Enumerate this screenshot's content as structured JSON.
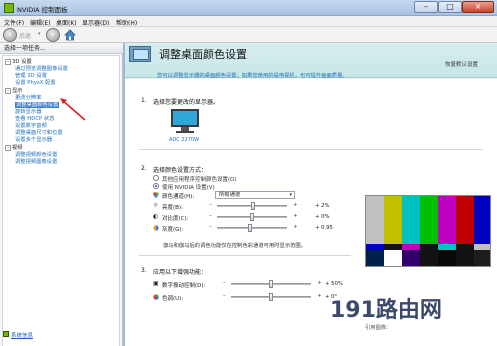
{
  "window": {
    "title": "NVIDIA 控制面板",
    "buttons": {
      "minimize": "–",
      "maximize": "□",
      "close": "×"
    }
  },
  "menu": [
    "文件(F)",
    "编辑(E)",
    "桌面(K)",
    "显示器(D)",
    "帮助(H)"
  ],
  "toolbar": {
    "back_label": "后退",
    "back_icon": "left-arrow-icon",
    "forward_icon": "right-arrow-icon",
    "home_icon": "home-icon"
  },
  "left": {
    "task_header": "选择一项任务...",
    "tree": [
      {
        "label": "3D 设置",
        "kind": "cat",
        "toggle": "–"
      },
      {
        "label": "通过预览调整图像设置",
        "kind": "leaf"
      },
      {
        "label": "管理 3D 设置",
        "kind": "leaf"
      },
      {
        "label": "设置 PhysX 配置",
        "kind": "leaf"
      },
      {
        "label": "显示",
        "kind": "cat",
        "toggle": "–"
      },
      {
        "label": "更改分辨率",
        "kind": "leaf"
      },
      {
        "label": "调整桌面颜色设置",
        "kind": "leaf",
        "selected": true
      },
      {
        "label": "旋转显示器",
        "kind": "leaf"
      },
      {
        "label": "查看 HDCP 状态",
        "kind": "leaf"
      },
      {
        "label": "设置数字音频",
        "kind": "leaf"
      },
      {
        "label": "调整桌面尺寸和位置",
        "kind": "leaf"
      },
      {
        "label": "设置多个显示器",
        "kind": "leaf"
      },
      {
        "label": "视频",
        "kind": "cat",
        "toggle": "–"
      },
      {
        "label": "调整视频颜色设置",
        "kind": "leaf"
      },
      {
        "label": "调整视频图像设置",
        "kind": "leaf"
      }
    ],
    "sysinfo": "系统信息"
  },
  "right": {
    "title": "调整桌面颜色设置",
    "restore": "恢复默认设置",
    "description": "您可以调整显示器的桌面颜色设置，如果您使用的是电视机，也可提升画面质量。",
    "section1": {
      "num": "1.",
      "title": "选择您要更改的显示器。",
      "monitor": "AOC 2270W"
    },
    "section2": {
      "num": "2.",
      "title": "选择颜色设置方式：",
      "option_other": "其他应用程序控制颜色设置(O)",
      "option_nvidia": "使用 NVIDIA 设置(V)",
      "channel_label": "颜色通道(H):",
      "channel_value": "所有通道",
      "brightness": {
        "label": "亮度(B):",
        "value": "+ 2%",
        "level": 0.52
      },
      "contrast": {
        "label": "对比度(C):",
        "value": "+ 0%",
        "level": 0.5
      },
      "gamma": {
        "label": "灰度(G):",
        "value": "+ 0.95",
        "level": 0.47
      },
      "note": "伽马和伽马后的调色功能仅在控制色彩通道可用时显示范围。"
    },
    "section3": {
      "num": "3.",
      "title": "应用以下增强功能：",
      "vibrance": {
        "label": "数字振动控制(D):",
        "value": "+ 50%",
        "level": 0.5
      },
      "hue": {
        "label": "色调(U):",
        "value": "+ 0°",
        "level": 0.5
      }
    },
    "reference_label": "引用图像：",
    "preview_colors": {
      "bars": [
        "#c0c0c0",
        "#c0c000",
        "#00c0c0",
        "#00c000",
        "#c000c0",
        "#c00000",
        "#0000c0"
      ],
      "row2": [
        "#0000c0",
        "#131313",
        "#c000c0",
        "#131313",
        "#00c0c0",
        "#131313",
        "#c0c0c0"
      ],
      "row3": [
        "#00214c",
        "#ffffff",
        "#32006a",
        "#131313",
        "#090909",
        "#131313",
        "#1d1d1d"
      ]
    }
  },
  "watermark": "191路由网",
  "colors": {
    "accent": "#76b900",
    "link": "#1f6fb8",
    "selected": "#3b7fd1",
    "header": "#c6e6e6"
  }
}
